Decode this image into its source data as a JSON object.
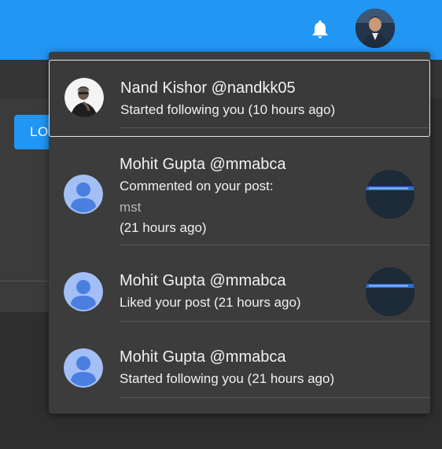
{
  "header": {
    "notification_icon": "bell-icon",
    "accent_color": "#2196f3"
  },
  "page": {
    "login_button_label": "LO"
  },
  "notifications": [
    {
      "name": "Nand Kishor @nandkk05",
      "line1": "Started following you (10 hours ago)",
      "avatar": "user-photo",
      "selected": true
    },
    {
      "name": "Mohit Gupta @mmabca",
      "line1": "Commented on your post:",
      "line2": "mst",
      "line3": "(21 hours ago)",
      "avatar": "default-avatar",
      "has_thumbnail": true
    },
    {
      "name": "Mohit Gupta @mmabca",
      "line1": "Liked your post (21 hours ago)",
      "avatar": "default-avatar",
      "has_thumbnail": true
    },
    {
      "name": "Mohit Gupta @mmabca",
      "line1": "Started following you (21 hours ago)",
      "avatar": "default-avatar"
    }
  ]
}
